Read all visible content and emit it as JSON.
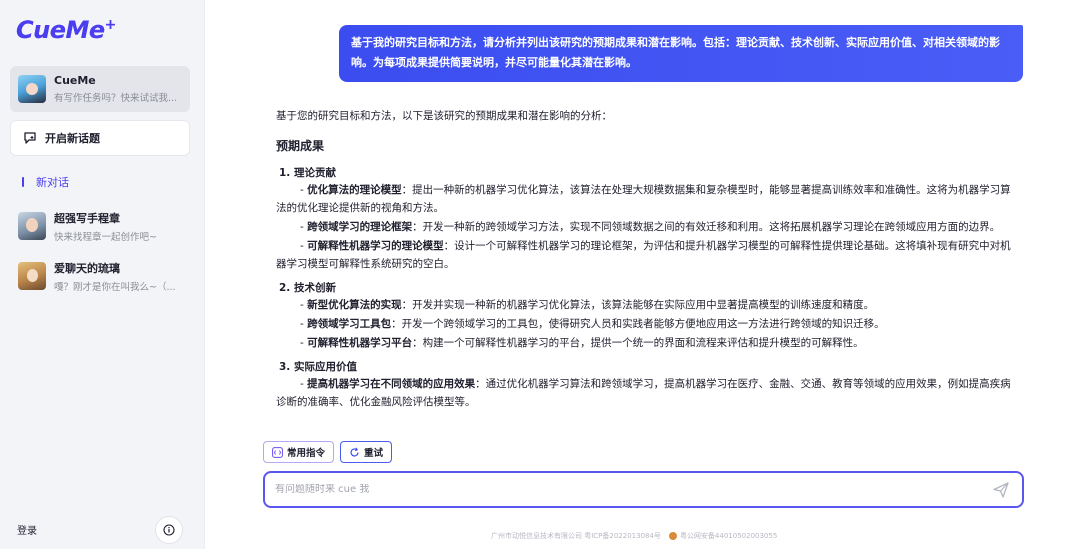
{
  "app": {
    "logo": "CueMe",
    "logo_mark": "+"
  },
  "sidebar": {
    "chats": [
      {
        "title": "CueMe",
        "subtitle": "有写作任务吗？快来试试我..."
      },
      {
        "title": "超强写手程章",
        "subtitle": "快来找程章一起创作吧~"
      },
      {
        "title": "爱聊天的琉璃",
        "subtitle": "嘎？刚才是你在叫我么~（..."
      }
    ],
    "new_chat_label": "开启新话题",
    "section_label": "新对话",
    "login_label": "登录"
  },
  "conversation": {
    "user_message": "基于我的研究目标和方法，请分析并列出该研究的预期成果和潜在影响。包括：理论贡献、技术创新、实际应用价值、对相关领域的影响。为每项成果提供简要说明，并尽可能量化其潜在影响。",
    "reply": {
      "intro": "基于您的研究目标和方法，以下是该研究的预期成果和潜在影响的分析：",
      "heading": "预期成果",
      "sections": [
        {
          "title": "1. 理论贡献",
          "items": [
            {
              "label": "优化算法的理论模型",
              "text": "：提出一种新的机器学习优化算法，该算法在处理大规模数据集和复杂模型时，能够显著提高训练效率和准确性。这将为机器学习算法的优化理论提供新的视角和方法。"
            },
            {
              "label": "跨领域学习的理论框架",
              "text": "：开发一种新的跨领域学习方法，实现不同领域数据之间的有效迁移和利用。这将拓展机器学习理论在跨领域应用方面的边界。"
            },
            {
              "label": "可解释性机器学习的理论模型",
              "text": "：设计一个可解释性机器学习的理论框架，为评估和提升机器学习模型的可解释性提供理论基础。这将填补现有研究中对机器学习模型可解释性系统研究的空白。"
            }
          ]
        },
        {
          "title": "2. 技术创新",
          "items": [
            {
              "label": "新型优化算法的实现",
              "text": "：开发并实现一种新的机器学习优化算法，该算法能够在实际应用中显著提高模型的训练速度和精度。"
            },
            {
              "label": "跨领域学习工具包",
              "text": "：开发一个跨领域学习的工具包，使得研究人员和实践者能够方便地应用这一方法进行跨领域的知识迁移。"
            },
            {
              "label": "可解释性机器学习平台",
              "text": "：构建一个可解释性机器学习的平台，提供一个统一的界面和流程来评估和提升模型的可解释性。"
            }
          ]
        },
        {
          "title": "3. 实际应用价值",
          "items": [
            {
              "label": "提高机器学习在不同领域的应用效果",
              "text": "：通过优化机器学习算法和跨领域学习，提高机器学习在医疗、金融、交通、教育等领域的应用效果，例如提高疾病诊断的准确率、优化金融风险评估模型等。"
            }
          ]
        }
      ]
    }
  },
  "tools": {
    "commands_label": "常用指令",
    "retry_label": "重试"
  },
  "input": {
    "placeholder": "有问题随时来 cue 我"
  },
  "footer": {
    "company": "广州市动悦信息技术有限公司 粤ICP备2022013084号",
    "police": "粤公网安备44010502003055"
  },
  "colors": {
    "accent": "#4b3ef1",
    "bubble": "#3b4df0",
    "sidebar_bg": "#f3f4f7"
  }
}
